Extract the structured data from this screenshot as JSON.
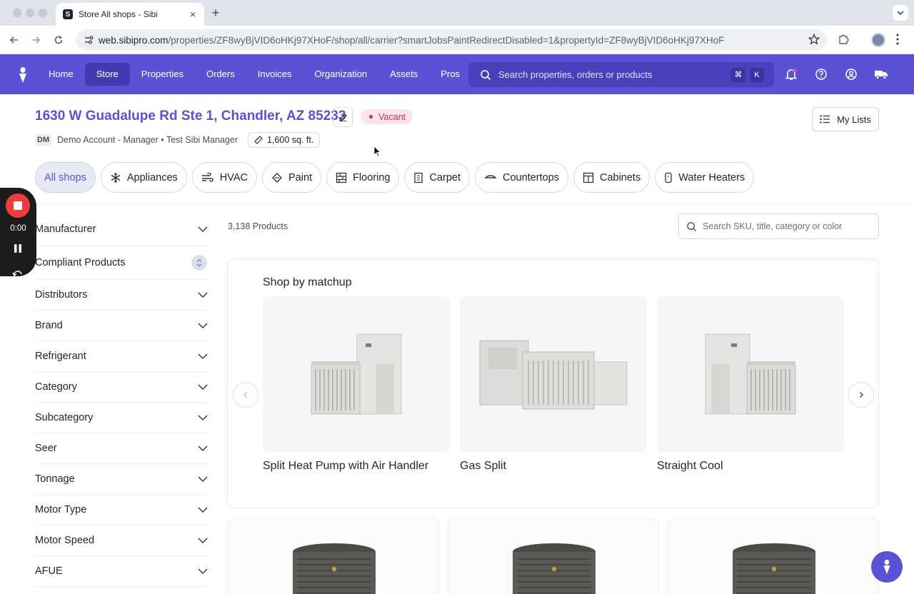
{
  "browser": {
    "tab_title": "Store All shops - Sibi",
    "tab_favicon": "S",
    "url_host": "web.sibipro.com",
    "url_path": "/properties/ZF8wyBjVID6oHKj97XHoF/shop/all/carrier?smartJobsPaintRedirectDisabled=1&propertyId=ZF8wyBjVID6oHKj97XHoF"
  },
  "nav": {
    "links": [
      "Home",
      "Store",
      "Properties",
      "Orders",
      "Invoices",
      "Organization",
      "Assets",
      "Pros"
    ],
    "active": "Store",
    "search_placeholder": "Search properties, orders or products",
    "kbd_cmd": "⌘",
    "kbd_k": "K"
  },
  "property": {
    "address": "1630 W Guadalupe Rd Ste 1, Chandler, AZ 85233",
    "status": "Vacant",
    "initials": "DM",
    "account": "Demo Account - Manager • Test Sibi Manager",
    "sqft": "1,600 sq. ft.",
    "my_lists": "My Lists"
  },
  "shops": [
    "All shops",
    "Appliances",
    "HVAC",
    "Paint",
    "Flooring",
    "Carpet",
    "Countertops",
    "Cabinets",
    "Water Heaters"
  ],
  "filters": [
    "Manufacturer",
    "Compliant Products",
    "Distributors",
    "Brand",
    "Refrigerant",
    "Category",
    "Subcategory",
    "Seer",
    "Tonnage",
    "Motor Type",
    "Motor Speed",
    "AFUE"
  ],
  "recorder": {
    "time": "0:00"
  },
  "main": {
    "product_count": "3,138 Products",
    "sku_search_placeholder": "Search SKU, title, category or color",
    "matchup_title": "Shop by matchup",
    "matchups": [
      "Split Heat Pump with Air Handler",
      "Gas Split",
      "Straight Cool"
    ]
  },
  "icons": {
    "accent": "#5a52d5",
    "badge_pink": "#fde4ec",
    "recorder_red": "#ef3b3b"
  }
}
